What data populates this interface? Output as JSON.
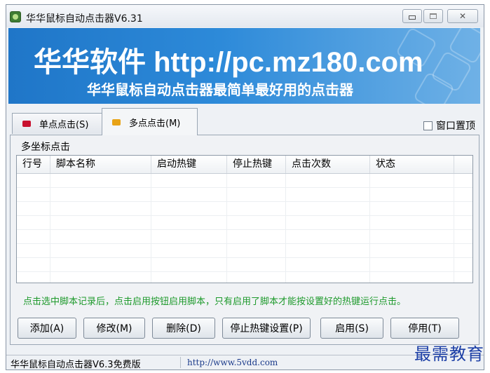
{
  "window": {
    "title": "华华鼠标自动点击器V6.31"
  },
  "banner": {
    "title": "华华软件 http://pc.mz180.com",
    "subtitle": "华华鼠标自动点击器最简单最好用的点击器"
  },
  "tabs": [
    {
      "label": "单点点击(S)",
      "color": "#c8102e"
    },
    {
      "label": "多点点击(M)",
      "color": "#e8a317"
    }
  ],
  "topmost_label": "窗口置顶",
  "group_label": "多坐标点击",
  "table": {
    "columns": [
      "行号",
      "脚本名称",
      "启动热键",
      "停止热键",
      "点击次数",
      "状态"
    ]
  },
  "hint": "点击选中脚本记录后，点击启用按钮启用脚本，只有启用了脚本才能按设置好的热键运行点击。",
  "buttons": {
    "add": "添加(A)",
    "edit": "修改(M)",
    "delete": "删除(D)",
    "stop_hotkey": "停止热键设置(P)",
    "enable": "启用(S)",
    "disable": "停用(T)"
  },
  "status": {
    "left": "华华鼠标自动点击器V6.3免费版",
    "url": "http://www.5vdd.com"
  },
  "watermark": "最需教育"
}
